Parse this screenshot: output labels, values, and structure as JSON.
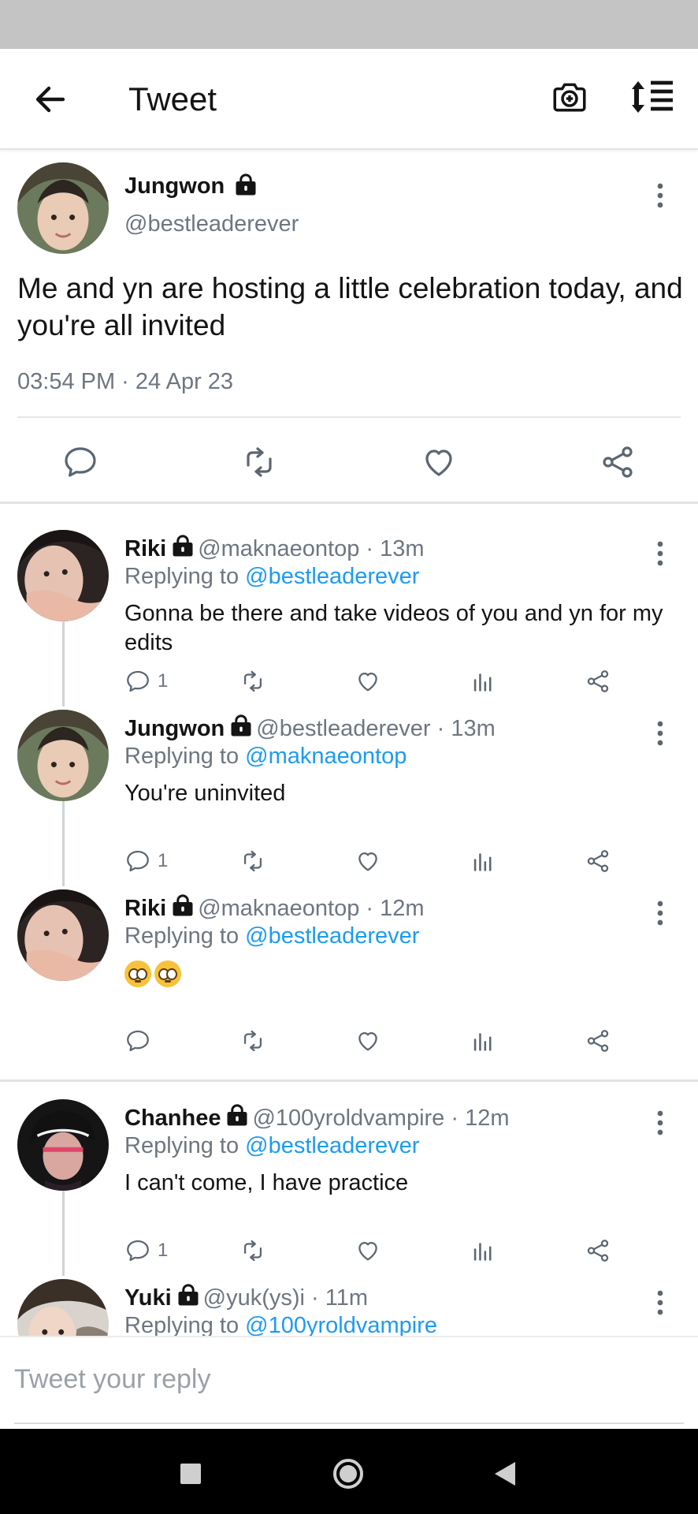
{
  "header": {
    "title": "Tweet",
    "icons": [
      "back-arrow-icon",
      "camera-plus-icon",
      "sort-icon"
    ]
  },
  "main_tweet": {
    "name": "Jungwon",
    "handle": "@bestleaderever",
    "text": "Me and yn are hosting a little celebration today, and you're all invited",
    "timestamp": "03:54 PM · 24 Apr 23"
  },
  "replies": [
    {
      "name": "Riki",
      "handle": "@maknaeontop",
      "time": "13m",
      "reply_prefix": "Replying to ",
      "reply_to": "@bestleaderever",
      "text": "Gonna be there and take videos of you and yn for my edits",
      "reply_count": "1"
    },
    {
      "name": "Jungwon",
      "handle": "@bestleaderever",
      "time": "13m",
      "reply_prefix": "Replying to ",
      "reply_to": "@maknaeontop",
      "text": "You're uninvited",
      "reply_count": "1"
    },
    {
      "name": "Riki",
      "handle": "@maknaeontop",
      "time": "12m",
      "reply_prefix": "Replying to ",
      "reply_to": "@bestleaderever",
      "text": "",
      "emoji": "🥺🥺",
      "reply_count": ""
    },
    {
      "name": "Chanhee",
      "handle": "@100yroldvampire",
      "time": "12m",
      "reply_prefix": "Replying to ",
      "reply_to": "@bestleaderever",
      "text": "I can't come, I have practice",
      "reply_count": "1"
    },
    {
      "name": "Yuki",
      "handle": "@yuk(ys)i",
      "time": "11m",
      "reply_prefix": "Replying to ",
      "reply_to": "@100yroldvampire"
    }
  ],
  "compose": {
    "placeholder": "Tweet your reply"
  },
  "colors": {
    "link": "#1d9bf0",
    "muted": "#6e7680",
    "text": "#141414"
  }
}
